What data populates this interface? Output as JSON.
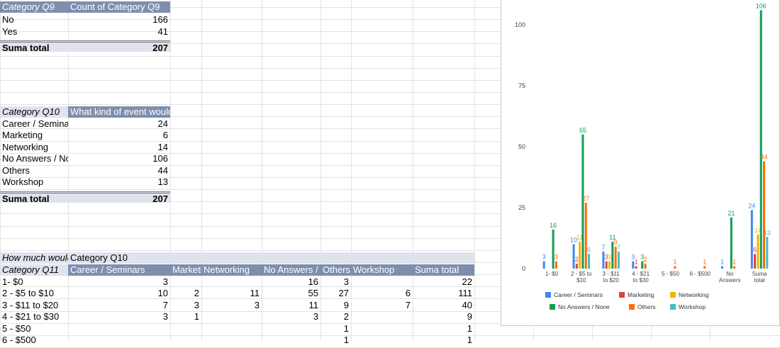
{
  "q9_table": {
    "header": [
      "Category Q9",
      "Count of Category Q9"
    ],
    "rows": [
      [
        "No",
        "166"
      ],
      [
        "Yes",
        "41"
      ]
    ],
    "total": [
      "Suma total",
      "207"
    ]
  },
  "q10_table": {
    "header": [
      "Category Q10",
      "What kind of event would"
    ],
    "rows": [
      [
        "Career / Seminars",
        "24"
      ],
      [
        "Marketing",
        "6"
      ],
      [
        "Networking",
        "14"
      ],
      [
        "No Answers / None",
        "106"
      ],
      [
        "Others",
        "44"
      ],
      [
        "Workshop",
        "13"
      ]
    ],
    "total": [
      "Suma total",
      "207"
    ]
  },
  "pivot": {
    "corner_label": "How much would",
    "col_group_label": "Category Q10",
    "row_header": "Category Q11",
    "columns": [
      "Career / Seminars",
      "Marketing",
      "Networking",
      "No Answers / None",
      "Others",
      "Workshop",
      "Suma total"
    ],
    "rows": [
      [
        "1- $0",
        "3",
        "",
        "",
        "16",
        "3",
        "",
        "22"
      ],
      [
        "2 - $5 to $10",
        "10",
        "2",
        "11",
        "55",
        "27",
        "6",
        "111"
      ],
      [
        "3 - $11 to $20",
        "7",
        "3",
        "3",
        "11",
        "9",
        "7",
        "40"
      ],
      [
        "4 - $21 to $30",
        "3",
        "1",
        "",
        "3",
        "2",
        "",
        "9"
      ],
      [
        "5 - $50",
        "",
        "",
        "",
        "",
        "1",
        "",
        "1"
      ],
      [
        "6 - $500",
        "",
        "",
        "",
        "",
        "1",
        "",
        "1"
      ]
    ]
  },
  "chart_data": {
    "type": "bar",
    "categories": [
      "1- $0",
      "2 - $5 to $10",
      "3 - $11 to $20",
      "4 - $21 to $30",
      "5 - $50",
      "6 - $500",
      "No Answers",
      "Suma total"
    ],
    "category_lines": [
      [
        "1- $0"
      ],
      [
        "2 - $5 to",
        "$10"
      ],
      [
        "3 - $11",
        "to $20"
      ],
      [
        "4 - $21",
        "to $30"
      ],
      [
        "5 - $50"
      ],
      [
        "6 - $500"
      ],
      [
        "No",
        "Answers"
      ],
      [
        "Suma",
        "total"
      ]
    ],
    "series": [
      {
        "name": "Career / Seminars",
        "color": "#4285f4",
        "values": [
          3,
          10,
          7,
          3,
          null,
          null,
          1,
          24
        ]
      },
      {
        "name": "Marketing",
        "color": "#db4437",
        "values": [
          null,
          2,
          3,
          1,
          null,
          null,
          null,
          6
        ]
      },
      {
        "name": "Networking",
        "color": "#f4b400",
        "values": [
          null,
          11,
          3,
          null,
          null,
          null,
          null,
          14
        ]
      },
      {
        "name": "No Answers / None",
        "color": "#0f9d58",
        "values": [
          16,
          55,
          11,
          3,
          null,
          null,
          21,
          106
        ]
      },
      {
        "name": "Others",
        "color": "#ff6d00",
        "values": [
          3,
          27,
          9,
          2,
          1,
          1,
          1,
          44
        ]
      },
      {
        "name": "Workshop",
        "color": "#46bdc6",
        "values": [
          null,
          6,
          7,
          null,
          null,
          null,
          null,
          13
        ]
      }
    ],
    "yticks": [
      0,
      25,
      50,
      75,
      100
    ],
    "ylim": [
      0,
      110
    ],
    "grid": false,
    "legend_position": "bottom"
  }
}
